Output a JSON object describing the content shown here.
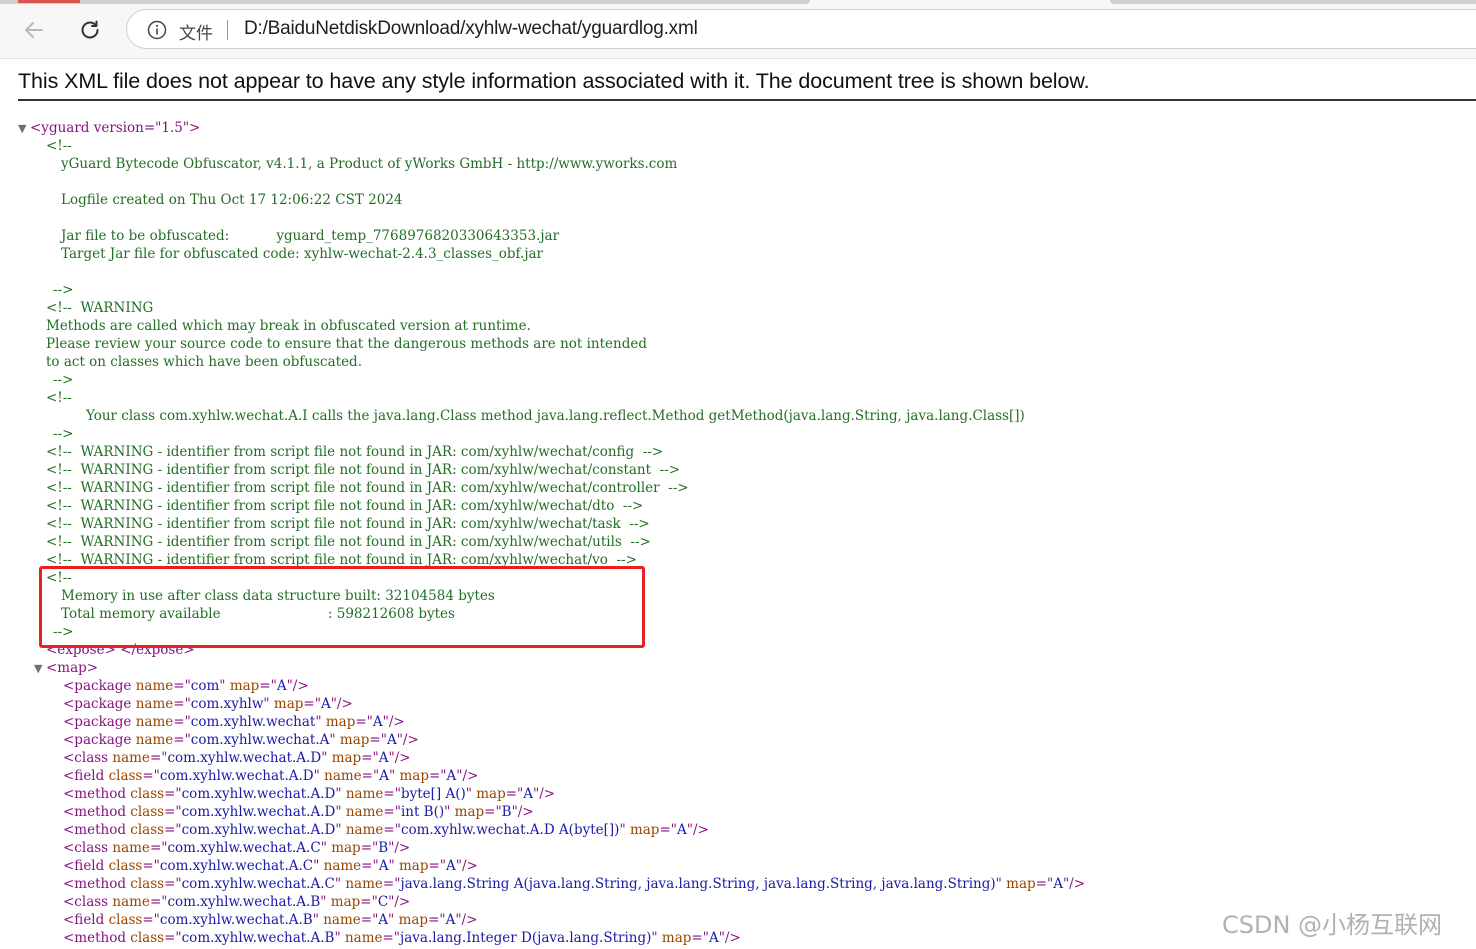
{
  "browser": {
    "scheme_label": "文件",
    "url": "D:/BaiduNetdiskDownload/xyhlw-wechat/yguardlog.xml"
  },
  "viewer": {
    "header_message": "This XML file does not appear to have any style information associated with it. The document tree is shown below."
  },
  "xml": {
    "root_open": "<yguard version=\"1.5\">",
    "header_comment": {
      "open": "<!--",
      "product": "yGuard Bytecode Obfuscator, v4.1.1, a Product of yWorks GmbH - http://www.yworks.com",
      "logfile": "Logfile created on Thu Oct 17 12:06:22 CST 2024",
      "jar_label": "Jar file to be obfuscated:           yguard_temp_7768976820330643353.jar",
      "target_label": "Target Jar file for obfuscated code: xyhlw-wechat-2.4.3_classes_obf.jar",
      "close": "-->"
    },
    "warning_comment": {
      "open": "<!--  WARNING",
      "line1": "Methods are called which may break in obfuscated version at runtime.",
      "line2": "Please review your source code to ensure that the dangerous methods are not intended",
      "line3": "to act on classes which have been obfuscated.",
      "close": "-->"
    },
    "reflection_comment": {
      "open": "<!--",
      "body": "Your class com.xyhlw.wechat.A.I calls the java.lang.Class method java.lang.reflect.Method getMethod(java.lang.String, java.lang.Class[])",
      "close": "-->"
    },
    "script_warnings": [
      "<!--  WARNING - identifier from script file not found in JAR: com/xyhlw/wechat/config  -->",
      "<!--  WARNING - identifier from script file not found in JAR: com/xyhlw/wechat/constant  -->",
      "<!--  WARNING - identifier from script file not found in JAR: com/xyhlw/wechat/controller  -->",
      "<!--  WARNING - identifier from script file not found in JAR: com/xyhlw/wechat/dto  -->",
      "<!--  WARNING - identifier from script file not found in JAR: com/xyhlw/wechat/task  -->",
      "<!--  WARNING - identifier from script file not found in JAR: com/xyhlw/wechat/utils  -->",
      "<!--  WARNING - identifier from script file not found in JAR: com/xyhlw/wechat/vo  -->"
    ],
    "memory_comment": {
      "open": "<!--",
      "line1": "Memory in use after class data structure built: 32104584 bytes",
      "line2": "Total memory available                         : 598212608 bytes",
      "close": "-->"
    },
    "expose_line": "<expose> </expose>",
    "map_open": "<map>",
    "map_entries": [
      [
        {
          "t": "tag",
          "v": "<package "
        },
        {
          "t": "an",
          "v": "name"
        },
        {
          "t": "tag",
          "v": "=\""
        },
        {
          "t": "av",
          "v": "com"
        },
        {
          "t": "tag",
          "v": "\" "
        },
        {
          "t": "an",
          "v": "map"
        },
        {
          "t": "tag",
          "v": "=\""
        },
        {
          "t": "av",
          "v": "A"
        },
        {
          "t": "tag",
          "v": "\"/>"
        }
      ],
      [
        {
          "t": "tag",
          "v": "<package "
        },
        {
          "t": "an",
          "v": "name"
        },
        {
          "t": "tag",
          "v": "=\""
        },
        {
          "t": "av",
          "v": "com.xyhlw"
        },
        {
          "t": "tag",
          "v": "\" "
        },
        {
          "t": "an",
          "v": "map"
        },
        {
          "t": "tag",
          "v": "=\""
        },
        {
          "t": "av",
          "v": "A"
        },
        {
          "t": "tag",
          "v": "\"/>"
        }
      ],
      [
        {
          "t": "tag",
          "v": "<package "
        },
        {
          "t": "an",
          "v": "name"
        },
        {
          "t": "tag",
          "v": "=\""
        },
        {
          "t": "av",
          "v": "com.xyhlw.wechat"
        },
        {
          "t": "tag",
          "v": "\" "
        },
        {
          "t": "an",
          "v": "map"
        },
        {
          "t": "tag",
          "v": "=\""
        },
        {
          "t": "av",
          "v": "A"
        },
        {
          "t": "tag",
          "v": "\"/>"
        }
      ],
      [
        {
          "t": "tag",
          "v": "<package "
        },
        {
          "t": "an",
          "v": "name"
        },
        {
          "t": "tag",
          "v": "=\""
        },
        {
          "t": "av",
          "v": "com.xyhlw.wechat.A"
        },
        {
          "t": "tag",
          "v": "\" "
        },
        {
          "t": "an",
          "v": "map"
        },
        {
          "t": "tag",
          "v": "=\""
        },
        {
          "t": "av",
          "v": "A"
        },
        {
          "t": "tag",
          "v": "\"/>"
        }
      ],
      [
        {
          "t": "tag",
          "v": "<class "
        },
        {
          "t": "an",
          "v": "name"
        },
        {
          "t": "tag",
          "v": "=\""
        },
        {
          "t": "av",
          "v": "com.xyhlw.wechat.A.D"
        },
        {
          "t": "tag",
          "v": "\" "
        },
        {
          "t": "an",
          "v": "map"
        },
        {
          "t": "tag",
          "v": "=\""
        },
        {
          "t": "av",
          "v": "A"
        },
        {
          "t": "tag",
          "v": "\"/>"
        }
      ],
      [
        {
          "t": "tag",
          "v": "<field "
        },
        {
          "t": "an",
          "v": "class"
        },
        {
          "t": "tag",
          "v": "=\""
        },
        {
          "t": "av",
          "v": "com.xyhlw.wechat.A.D"
        },
        {
          "t": "tag",
          "v": "\" "
        },
        {
          "t": "an",
          "v": "name"
        },
        {
          "t": "tag",
          "v": "=\""
        },
        {
          "t": "av",
          "v": "A"
        },
        {
          "t": "tag",
          "v": "\" "
        },
        {
          "t": "an",
          "v": "map"
        },
        {
          "t": "tag",
          "v": "=\""
        },
        {
          "t": "av",
          "v": "A"
        },
        {
          "t": "tag",
          "v": "\"/>"
        }
      ],
      [
        {
          "t": "tag",
          "v": "<method "
        },
        {
          "t": "an",
          "v": "class"
        },
        {
          "t": "tag",
          "v": "=\""
        },
        {
          "t": "av",
          "v": "com.xyhlw.wechat.A.D"
        },
        {
          "t": "tag",
          "v": "\" "
        },
        {
          "t": "an",
          "v": "name"
        },
        {
          "t": "tag",
          "v": "=\""
        },
        {
          "t": "av",
          "v": "byte[] A()"
        },
        {
          "t": "tag",
          "v": "\" "
        },
        {
          "t": "an",
          "v": "map"
        },
        {
          "t": "tag",
          "v": "=\""
        },
        {
          "t": "av",
          "v": "A"
        },
        {
          "t": "tag",
          "v": "\"/>"
        }
      ],
      [
        {
          "t": "tag",
          "v": "<method "
        },
        {
          "t": "an",
          "v": "class"
        },
        {
          "t": "tag",
          "v": "=\""
        },
        {
          "t": "av",
          "v": "com.xyhlw.wechat.A.D"
        },
        {
          "t": "tag",
          "v": "\" "
        },
        {
          "t": "an",
          "v": "name"
        },
        {
          "t": "tag",
          "v": "=\""
        },
        {
          "t": "av",
          "v": "int B()"
        },
        {
          "t": "tag",
          "v": "\" "
        },
        {
          "t": "an",
          "v": "map"
        },
        {
          "t": "tag",
          "v": "=\""
        },
        {
          "t": "av",
          "v": "B"
        },
        {
          "t": "tag",
          "v": "\"/>"
        }
      ],
      [
        {
          "t": "tag",
          "v": "<method "
        },
        {
          "t": "an",
          "v": "class"
        },
        {
          "t": "tag",
          "v": "=\""
        },
        {
          "t": "av",
          "v": "com.xyhlw.wechat.A.D"
        },
        {
          "t": "tag",
          "v": "\" "
        },
        {
          "t": "an",
          "v": "name"
        },
        {
          "t": "tag",
          "v": "=\""
        },
        {
          "t": "av",
          "v": "com.xyhlw.wechat.A.D A(byte[])"
        },
        {
          "t": "tag",
          "v": "\" "
        },
        {
          "t": "an",
          "v": "map"
        },
        {
          "t": "tag",
          "v": "=\""
        },
        {
          "t": "av",
          "v": "A"
        },
        {
          "t": "tag",
          "v": "\"/>"
        }
      ],
      [
        {
          "t": "tag",
          "v": "<class "
        },
        {
          "t": "an",
          "v": "name"
        },
        {
          "t": "tag",
          "v": "=\""
        },
        {
          "t": "av",
          "v": "com.xyhlw.wechat.A.C"
        },
        {
          "t": "tag",
          "v": "\" "
        },
        {
          "t": "an",
          "v": "map"
        },
        {
          "t": "tag",
          "v": "=\""
        },
        {
          "t": "av",
          "v": "B"
        },
        {
          "t": "tag",
          "v": "\"/>"
        }
      ],
      [
        {
          "t": "tag",
          "v": "<field "
        },
        {
          "t": "an",
          "v": "class"
        },
        {
          "t": "tag",
          "v": "=\""
        },
        {
          "t": "av",
          "v": "com.xyhlw.wechat.A.C"
        },
        {
          "t": "tag",
          "v": "\" "
        },
        {
          "t": "an",
          "v": "name"
        },
        {
          "t": "tag",
          "v": "=\""
        },
        {
          "t": "av",
          "v": "A"
        },
        {
          "t": "tag",
          "v": "\" "
        },
        {
          "t": "an",
          "v": "map"
        },
        {
          "t": "tag",
          "v": "=\""
        },
        {
          "t": "av",
          "v": "A"
        },
        {
          "t": "tag",
          "v": "\"/>"
        }
      ],
      [
        {
          "t": "tag",
          "v": "<method "
        },
        {
          "t": "an",
          "v": "class"
        },
        {
          "t": "tag",
          "v": "=\""
        },
        {
          "t": "av",
          "v": "com.xyhlw.wechat.A.C"
        },
        {
          "t": "tag",
          "v": "\" "
        },
        {
          "t": "an",
          "v": "name"
        },
        {
          "t": "tag",
          "v": "=\""
        },
        {
          "t": "av",
          "v": "java.lang.String A(java.lang.String, java.lang.String, java.lang.String, java.lang.String)"
        },
        {
          "t": "tag",
          "v": "\" "
        },
        {
          "t": "an",
          "v": "map"
        },
        {
          "t": "tag",
          "v": "=\""
        },
        {
          "t": "av",
          "v": "A"
        },
        {
          "t": "tag",
          "v": "\"/>"
        }
      ],
      [
        {
          "t": "tag",
          "v": "<class "
        },
        {
          "t": "an",
          "v": "name"
        },
        {
          "t": "tag",
          "v": "=\""
        },
        {
          "t": "av",
          "v": "com.xyhlw.wechat.A.B"
        },
        {
          "t": "tag",
          "v": "\" "
        },
        {
          "t": "an",
          "v": "map"
        },
        {
          "t": "tag",
          "v": "=\""
        },
        {
          "t": "av",
          "v": "C"
        },
        {
          "t": "tag",
          "v": "\"/>"
        }
      ],
      [
        {
          "t": "tag",
          "v": "<field "
        },
        {
          "t": "an",
          "v": "class"
        },
        {
          "t": "tag",
          "v": "=\""
        },
        {
          "t": "av",
          "v": "com.xyhlw.wechat.A.B"
        },
        {
          "t": "tag",
          "v": "\" "
        },
        {
          "t": "an",
          "v": "name"
        },
        {
          "t": "tag",
          "v": "=\""
        },
        {
          "t": "av",
          "v": "A"
        },
        {
          "t": "tag",
          "v": "\" "
        },
        {
          "t": "an",
          "v": "map"
        },
        {
          "t": "tag",
          "v": "=\""
        },
        {
          "t": "av",
          "v": "A"
        },
        {
          "t": "tag",
          "v": "\"/>"
        }
      ],
      [
        {
          "t": "tag",
          "v": "<method "
        },
        {
          "t": "an",
          "v": "class"
        },
        {
          "t": "tag",
          "v": "=\""
        },
        {
          "t": "av",
          "v": "com.xyhlw.wechat.A.B"
        },
        {
          "t": "tag",
          "v": "\" "
        },
        {
          "t": "an",
          "v": "name"
        },
        {
          "t": "tag",
          "v": "=\""
        },
        {
          "t": "av",
          "v": "java.lang.Integer D(java.lang.String)"
        },
        {
          "t": "tag",
          "v": "\" "
        },
        {
          "t": "an",
          "v": "map"
        },
        {
          "t": "tag",
          "v": "=\""
        },
        {
          "t": "av",
          "v": "A"
        },
        {
          "t": "tag",
          "v": "\"/>"
        }
      ]
    ]
  },
  "watermark": "CSDN @小杨互联网",
  "colors": {
    "tag": "#881280",
    "attribute_name": "#994500",
    "attribute_value": "#1a1aa6",
    "comment": "#236e25",
    "highlight_box": "#e8201f"
  }
}
